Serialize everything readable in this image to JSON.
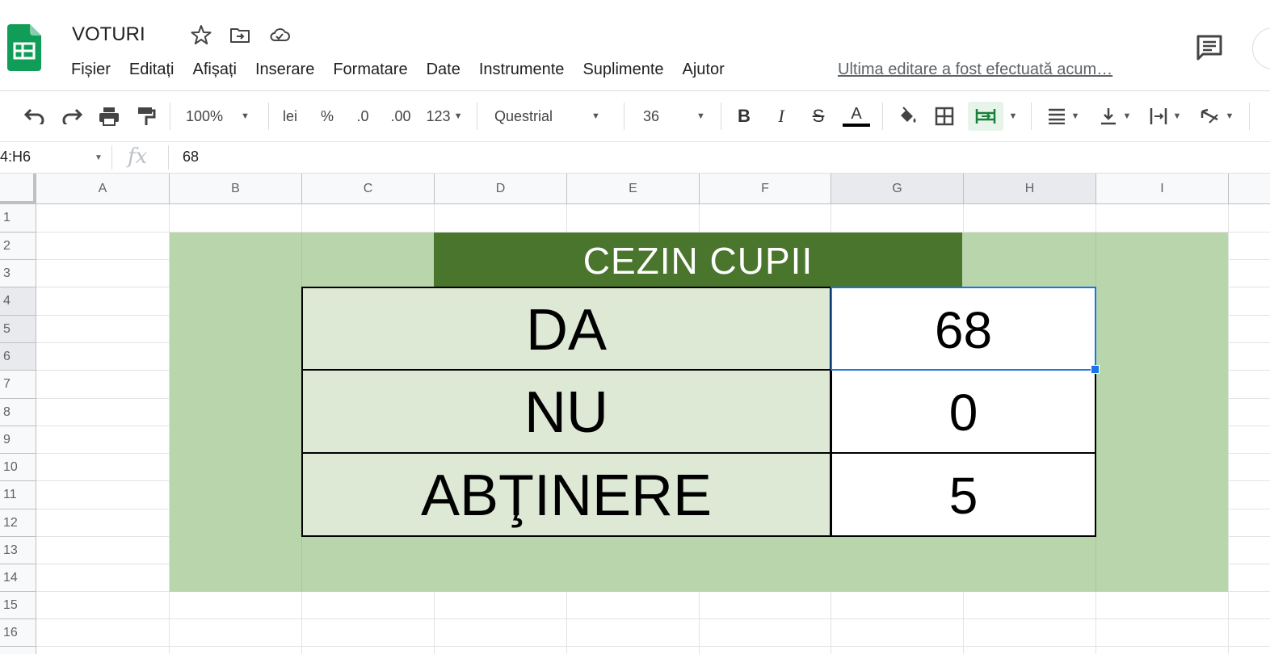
{
  "app": {
    "doc_title": "VOTURI",
    "menu": [
      "Fișier",
      "Editați",
      "Afișați",
      "Inserare",
      "Formatare",
      "Date",
      "Instrumente",
      "Suplimente",
      "Ajutor"
    ],
    "last_edit": "Ultima editare a fost efectuată acum…",
    "brand_color": "#0f9d58"
  },
  "toolbar": {
    "zoom": "100%",
    "currency": "lei",
    "percent": "%",
    "decrease_decimals": ".0",
    "increase_decimals": ".00",
    "more_formats": "123",
    "font": "Questrial",
    "font_size": "36",
    "bold": "B",
    "italic": "I",
    "strikethrough": "S",
    "text_color_glyph": "A",
    "text_color": "#000000"
  },
  "formula_bar": {
    "name_box": "4:H6",
    "formula": "68"
  },
  "grid": {
    "columns": [
      "A",
      "B",
      "C",
      "D",
      "E",
      "F",
      "G",
      "H",
      "I"
    ],
    "rows": [
      "1",
      "2",
      "3",
      "4",
      "5",
      "6",
      "7",
      "8",
      "9",
      "10",
      "11",
      "12",
      "13",
      "14",
      "15",
      "16"
    ],
    "selected_columns": [
      "G",
      "H"
    ],
    "selected_rows": [
      "4",
      "5",
      "6"
    ]
  },
  "sheet": {
    "banner": "CEZIN CUPII",
    "banner_color": "#4a752d",
    "block_color": "#b9d5ab",
    "label_fill": "#dde8d5",
    "votes": [
      {
        "label": "DA",
        "value": "68"
      },
      {
        "label": "NU",
        "value": "0"
      },
      {
        "label": "ABŢINERE",
        "value": "5"
      }
    ]
  }
}
